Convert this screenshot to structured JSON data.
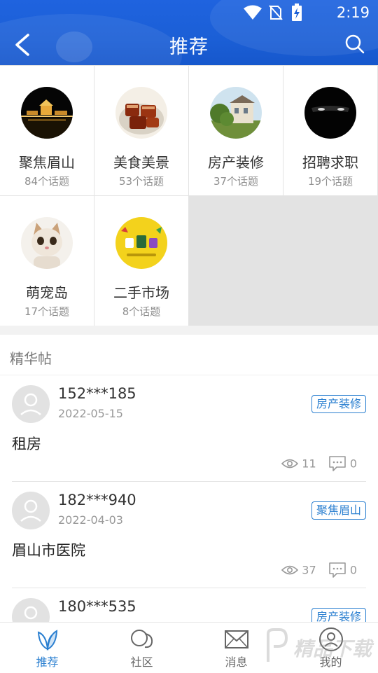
{
  "status_bar": {
    "time": "2:19"
  },
  "header": {
    "title": "推荐"
  },
  "topics": [
    {
      "name": "聚焦眉山",
      "count": "84个话题"
    },
    {
      "name": "美食美景",
      "count": "53个话题"
    },
    {
      "name": "房产装修",
      "count": "37个话题"
    },
    {
      "name": "招聘求职",
      "count": "19个话题"
    },
    {
      "name": "萌宠岛",
      "count": "17个话题"
    },
    {
      "name": "二手市场",
      "count": "8个话题"
    }
  ],
  "featured": {
    "title": "精华帖",
    "posts": [
      {
        "user": "152***185",
        "date": "2022-05-15",
        "tag": "房产装修",
        "content": "租房",
        "views": "11",
        "comments": "0"
      },
      {
        "user": "182***940",
        "date": "2022-04-03",
        "tag": "聚焦眉山",
        "content": "眉山市医院",
        "views": "37",
        "comments": "0"
      },
      {
        "user": "180***535",
        "date": "",
        "tag": "房产装修",
        "content": "",
        "views": "",
        "comments": ""
      }
    ]
  },
  "tabbar": {
    "tabs": [
      {
        "label": "推荐",
        "icon": "leaf-icon",
        "active": true
      },
      {
        "label": "社区",
        "icon": "chat-bubbles-icon",
        "active": false
      },
      {
        "label": "消息",
        "icon": "envelope-icon",
        "active": false
      },
      {
        "label": "我的",
        "icon": "person-icon",
        "active": false
      }
    ]
  },
  "watermark": {
    "text": "精品下载"
  },
  "colors": {
    "header_blue": "#1b5fd6",
    "accent": "#2a7fd0"
  }
}
